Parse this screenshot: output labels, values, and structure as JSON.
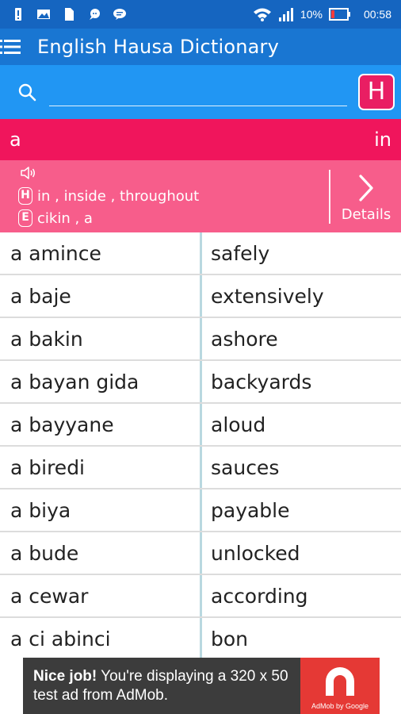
{
  "status_bar": {
    "battery": "10%",
    "time": "00:58"
  },
  "app": {
    "title": "English Hausa Dictionary"
  },
  "search": {
    "value": "",
    "placeholder": "",
    "lang_toggle": "H"
  },
  "selected_entry": {
    "word": "a",
    "translation": "in",
    "definitions": [
      {
        "badge": "H",
        "text": "in , inside , throughout"
      },
      {
        "badge": "E",
        "text": "cikin , a"
      }
    ],
    "details_label": "Details"
  },
  "word_list": [
    {
      "hausa": "a amince",
      "english": "safely"
    },
    {
      "hausa": "a baje",
      "english": "extensively"
    },
    {
      "hausa": "a bakin",
      "english": "ashore"
    },
    {
      "hausa": "a bayan gida",
      "english": "backyards"
    },
    {
      "hausa": "a bayyane",
      "english": "aloud"
    },
    {
      "hausa": "a biredi",
      "english": "sauces"
    },
    {
      "hausa": "a biya",
      "english": "payable"
    },
    {
      "hausa": "a bude",
      "english": "unlocked"
    },
    {
      "hausa": "a cewar",
      "english": "according"
    },
    {
      "hausa": "a ci abinci",
      "english": "bon"
    }
  ],
  "ad": {
    "headline": "Nice job!",
    "body": " You're displaying a 320 x 50 test ad from AdMob.",
    "logo_caption": "AdMob by Google"
  },
  "colors": {
    "status_bar": "#1565c0",
    "app_bar": "#1976d2",
    "search_bar": "#2196f3",
    "accent": "#e91e63",
    "word_header": "#f0155c",
    "definition_panel": "#f75d8b",
    "ad_background": "#3c3c3c",
    "ad_logo": "#e53935"
  }
}
